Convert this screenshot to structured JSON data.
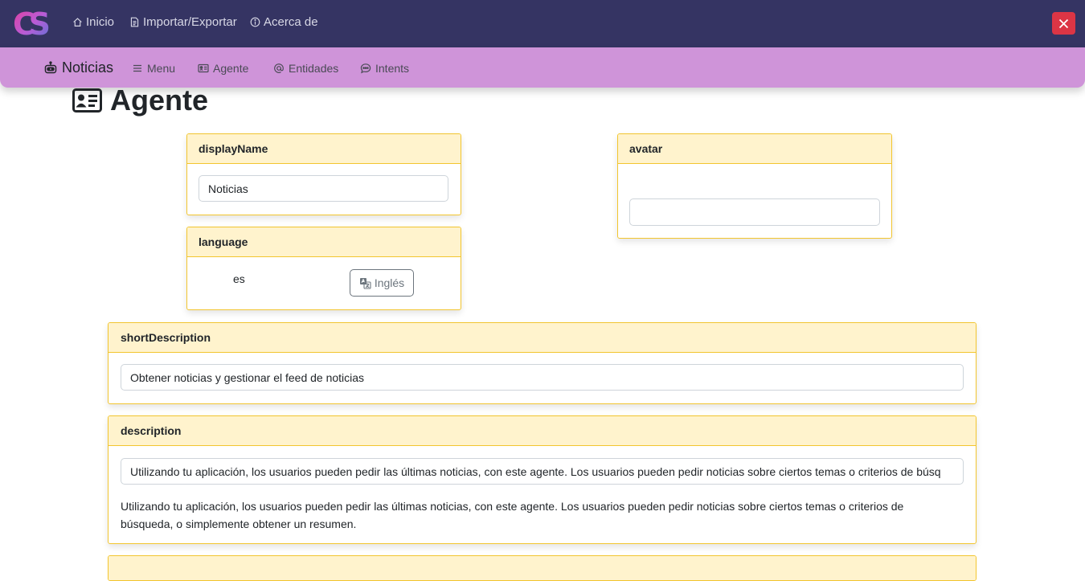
{
  "topbar": {
    "logo_text": "CS",
    "nav": [
      {
        "label": "Inicio",
        "icon": "home-icon"
      },
      {
        "label": "Importar/Exportar",
        "icon": "file-icon"
      },
      {
        "label": "Acerca de",
        "icon": "info-icon"
      }
    ],
    "close_color": "#dc3545"
  },
  "subbar": {
    "brand": "Noticias",
    "items": [
      {
        "label": "Menu",
        "icon": "list-icon"
      },
      {
        "label": "Agente",
        "icon": "person-card-icon"
      },
      {
        "label": "Entidades",
        "icon": "at-icon"
      },
      {
        "label": "Intents",
        "icon": "chat-dots-icon"
      }
    ]
  },
  "page": {
    "title": "Agente"
  },
  "fields": {
    "displayName": {
      "label": "displayName",
      "value": "Noticias"
    },
    "avatar": {
      "label": "avatar",
      "value": ""
    },
    "language": {
      "label": "language",
      "value": "es",
      "button": "Inglés"
    },
    "shortDescription": {
      "label": "shortDescription",
      "value": "Obtener noticias y gestionar el feed de noticias"
    },
    "description": {
      "label": "description",
      "value": "Utilizando tu aplicación, los usuarios pueden pedir las últimas noticias, con este agente. Los usuarios pueden pedir noticias sobre ciertos temas o criterios de búsq",
      "preview": "Utilizando tu aplicación, los usuarios pueden pedir las últimas noticias, con este agente. Los usuarios pueden pedir noticias sobre ciertos temas o criterios de búsqueda, o simplemente obtener un resumen."
    }
  },
  "colors": {
    "topbar_bg": "#353463",
    "subbar_bg": "#cf94d9",
    "card_border": "#f2c52f",
    "card_header_bg": "#fff3cd"
  }
}
